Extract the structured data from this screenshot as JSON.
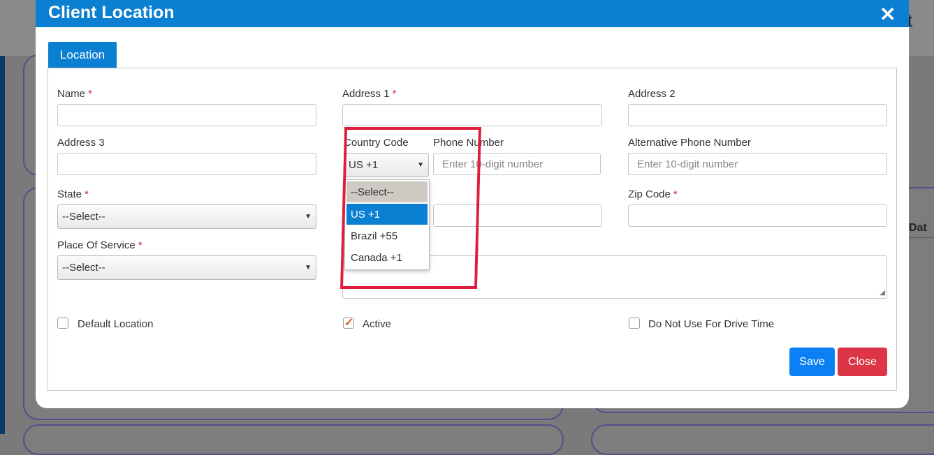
{
  "dialog": {
    "title": "Client Location",
    "close_symbol": "✕"
  },
  "tabs": [
    {
      "label": "Location"
    }
  ],
  "form": {
    "name": {
      "label": "Name",
      "required": "*",
      "value": ""
    },
    "address1": {
      "label": "Address 1",
      "required": "*",
      "value": ""
    },
    "address2": {
      "label": "Address 2",
      "value": ""
    },
    "address3": {
      "label": "Address 3",
      "value": ""
    },
    "country_code": {
      "label": "Country Code",
      "selected": "US +1"
    },
    "phone": {
      "label": "Phone Number",
      "placeholder": "Enter 10-digit number"
    },
    "alt_phone": {
      "label": "Alternative Phone Number",
      "placeholder": "Enter 10-digit number"
    },
    "state": {
      "label": "State",
      "required": "*",
      "selected": "--Select--"
    },
    "zip": {
      "label": "Zip Code",
      "required": "*",
      "value": ""
    },
    "place_of_service": {
      "label": "Place Of Service",
      "required": "*",
      "selected": "--Select--"
    },
    "notes": {
      "value": ""
    },
    "default_location": {
      "label": "Default Location",
      "checked": false
    },
    "active": {
      "label": "Active",
      "checked": true
    },
    "no_drive_time": {
      "label": "Do Not Use For Drive Time",
      "checked": false
    }
  },
  "country_dropdown": {
    "options": [
      "--Select--",
      "US +1",
      "Brazil +55",
      "Canada +1"
    ],
    "highlighted": "US +1"
  },
  "buttons": {
    "save": "Save",
    "close": "Close"
  },
  "background": {
    "glyph": "t",
    "column_header": "Dat"
  },
  "colors": {
    "header_blue": "#0b7fd1",
    "save_blue": "#0d7ff5",
    "close_red": "#dc3545",
    "required_red": "#d9232e",
    "annotation_red": "#e01e3c"
  }
}
